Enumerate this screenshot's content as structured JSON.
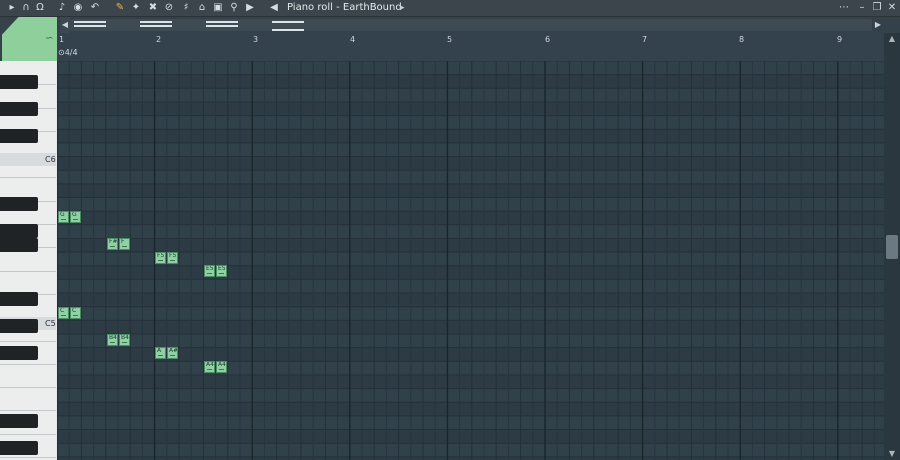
{
  "window": {
    "title": "Piano roll - EarthBound"
  },
  "toolbar": {
    "icons": [
      "menu-arrow-icon",
      "magnet-icon",
      "headphones-icon",
      "note-icon",
      "record-icon",
      "undo-icon",
      "pencil-icon",
      "paint-icon",
      "delete-icon",
      "mute-icon",
      "slice-icon",
      "select-icon",
      "zoom-icon",
      "playback-icon",
      "speaker-icon"
    ]
  },
  "ruler": {
    "bars": [
      "1",
      "2",
      "3",
      "4",
      "5",
      "6",
      "7",
      "8",
      "9"
    ],
    "time_signature": "4/4"
  },
  "piano": {
    "labels": [
      "C6",
      "C5"
    ]
  },
  "notes": [
    {
      "label": "G"
    },
    {
      "label": "G"
    },
    {
      "label": "F#5"
    },
    {
      "label": "F"
    },
    {
      "label": "F5"
    },
    {
      "label": "F5"
    },
    {
      "label": "E5"
    },
    {
      "label": "E5"
    },
    {
      "label": "C"
    },
    {
      "label": "C"
    },
    {
      "label": "B4"
    },
    {
      "label": "B4"
    },
    {
      "label": "A"
    },
    {
      "label": "A#"
    },
    {
      "label": "A4"
    },
    {
      "label": "A4"
    }
  ],
  "colors": {
    "note_fill": "#8fd1a4",
    "grid_bg": "#2f3f48",
    "corner_accent": "#8fcf9c"
  }
}
